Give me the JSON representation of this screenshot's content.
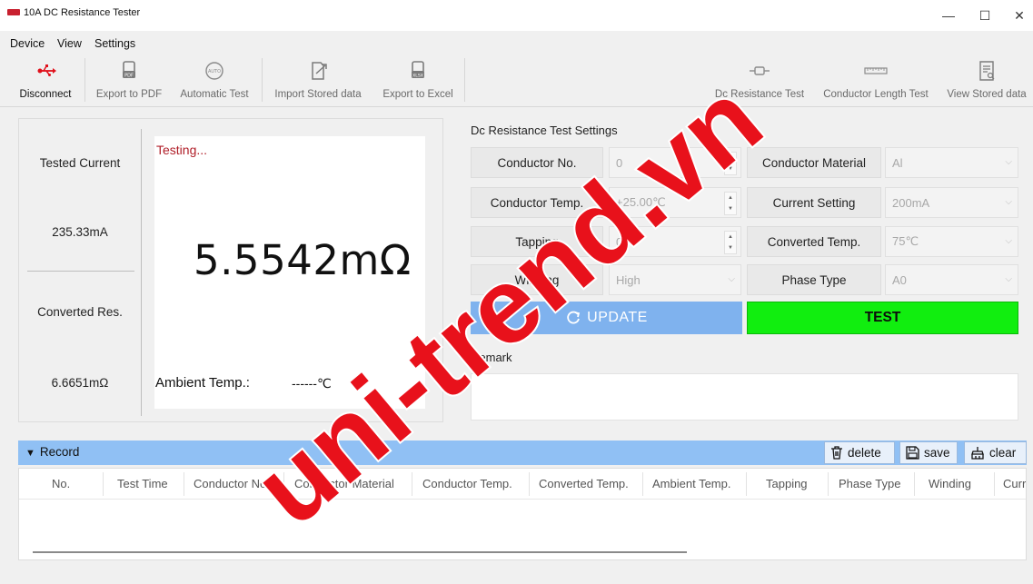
{
  "window": {
    "title": "10A DC Resistance Tester",
    "minimize": "—",
    "maximize": "☐",
    "close": "✕"
  },
  "menu": [
    "Device",
    "View",
    "Settings"
  ],
  "toolbar": {
    "left": [
      {
        "label": "Disconnect",
        "icon": "usb-icon"
      },
      {
        "label": "Export to PDF",
        "icon": "pdf-icon"
      },
      {
        "label": "Automatic Test",
        "icon": "auto-icon"
      },
      {
        "label": "Import Stored data",
        "icon": "import-icon"
      },
      {
        "label": "Export to Excel",
        "icon": "xlsx-icon"
      }
    ],
    "right": [
      {
        "label": "Dc Resistance Test",
        "icon": "resistor-icon"
      },
      {
        "label": "Conductor Length Test",
        "icon": "ruler-icon"
      },
      {
        "label": "View Stored data",
        "icon": "document-search-icon"
      }
    ]
  },
  "left_panel": {
    "tested_current_label": "Tested Current",
    "tested_current_value": "235.33mA",
    "converted_res_label": "Converted Res.",
    "converted_res_value": "6.6651mΩ",
    "status": "Testing...",
    "main_value": "5.5542mΩ",
    "ambient_label": "Ambient Temp.:",
    "ambient_value": "------℃"
  },
  "settings": {
    "title": "Dc Resistance Test Settings",
    "conductor_no_label": "Conductor No.",
    "conductor_no_value": "0",
    "conductor_material_label": "Conductor Material",
    "conductor_material_value": "Al",
    "conductor_temp_label": "Conductor Temp.",
    "conductor_temp_value": "+25.00℃",
    "current_setting_label": "Current Setting",
    "current_setting_value": "200mA",
    "tapping_label": "Tapping",
    "tapping_value": "00",
    "converted_temp_label": "Converted Temp.",
    "converted_temp_value": "75℃",
    "winding_label": "Winding",
    "winding_value": "High",
    "phase_type_label": "Phase Type",
    "phase_type_value": "A0",
    "update_label": "UPDATE",
    "test_label": "TEST",
    "remark_label": "Remark"
  },
  "record": {
    "title": "Record",
    "delete_label": "delete",
    "save_label": "save",
    "clear_label": "clear",
    "columns": [
      "No.",
      "Test Time",
      "Conductor No.",
      "Conductor Material",
      "Conductor Temp.",
      "Converted Temp.",
      "Ambient Temp.",
      "Tapping",
      "Phase Type",
      "Winding",
      "Curr"
    ]
  },
  "watermark": "uni-trend.vn",
  "colors": {
    "update_button": "#7fb2ee",
    "test_button": "#11ee0f",
    "record_bar": "#90c0f4",
    "status_text": "#b01e28",
    "watermark": "#e8111b"
  }
}
